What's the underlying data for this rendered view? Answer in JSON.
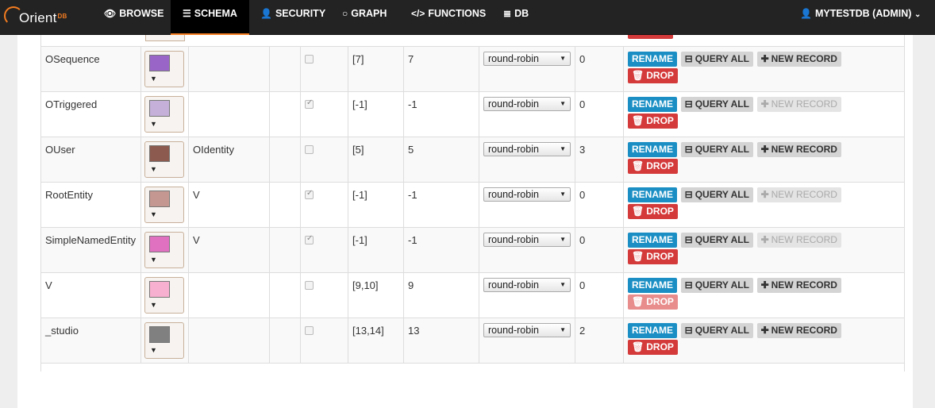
{
  "nav": {
    "brand": "Orient",
    "brand_suffix": "DB",
    "items": [
      {
        "label": "BROWSE",
        "icon": "eye-icon",
        "glyph": "👁"
      },
      {
        "label": "SCHEMA",
        "icon": "list-icon",
        "glyph": "☰"
      },
      {
        "label": "SECURITY",
        "icon": "user-icon",
        "glyph": "👤"
      },
      {
        "label": "GRAPH",
        "icon": "circle-icon",
        "glyph": "○"
      },
      {
        "label": "FUNCTIONS",
        "icon": "code-icon",
        "glyph": "</>"
      },
      {
        "label": "DB",
        "icon": "database-icon",
        "glyph": "≣"
      }
    ],
    "user": "MYTESTDB (ADMIN)",
    "user_caret": "⌄"
  },
  "actions": {
    "rename": "RENAME",
    "query_all": "QUERY ALL",
    "new_record": "NEW RECORD",
    "drop": "DROP"
  },
  "colors": {
    "accent": "#f47c20",
    "rename": "#1b8fc4",
    "drop": "#d43a3a"
  },
  "rows": [
    {
      "name": "OSequence",
      "color": "#9966c8",
      "superclass": "",
      "abstract": false,
      "clusters": "[7]",
      "default_cluster": "7",
      "selection": "round-robin",
      "records": "0",
      "new_enabled": true,
      "drop_enabled": true
    },
    {
      "name": "OTriggered",
      "color": "#c4b0d8",
      "superclass": "",
      "abstract": true,
      "clusters": "[-1]",
      "default_cluster": "-1",
      "selection": "round-robin",
      "records": "0",
      "new_enabled": false,
      "drop_enabled": true
    },
    {
      "name": "OUser",
      "color": "#8c5a4e",
      "superclass": "OIdentity",
      "abstract": false,
      "clusters": "[5]",
      "default_cluster": "5",
      "selection": "round-robin",
      "records": "3",
      "new_enabled": true,
      "drop_enabled": true
    },
    {
      "name": "RootEntity",
      "color": "#c49890",
      "superclass": "V",
      "abstract": true,
      "clusters": "[-1]",
      "default_cluster": "-1",
      "selection": "round-robin",
      "records": "0",
      "new_enabled": false,
      "drop_enabled": true
    },
    {
      "name": "SimpleNamedEntity",
      "color": "#e070c0",
      "superclass": "V",
      "abstract": true,
      "clusters": "[-1]",
      "default_cluster": "-1",
      "selection": "round-robin",
      "records": "0",
      "new_enabled": false,
      "drop_enabled": true
    },
    {
      "name": "V",
      "color": "#f8b0d0",
      "superclass": "",
      "abstract": false,
      "clusters": "[9,10]",
      "default_cluster": "9",
      "selection": "round-robin",
      "records": "0",
      "new_enabled": true,
      "drop_enabled": false
    },
    {
      "name": "_studio",
      "color": "#808080",
      "superclass": "",
      "abstract": false,
      "clusters": "[13,14]",
      "default_cluster": "13",
      "selection": "round-robin",
      "records": "2",
      "new_enabled": true,
      "drop_enabled": true
    }
  ]
}
